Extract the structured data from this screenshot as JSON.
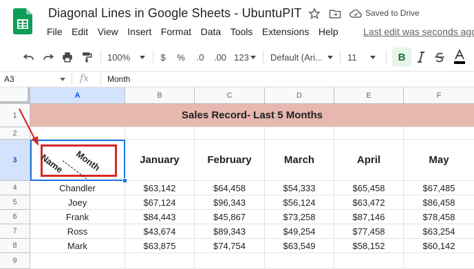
{
  "doc": {
    "title": "Diagonal Lines in Google Sheets - UbuntuPIT",
    "saved_status": "Saved to Drive",
    "last_edit": "Last edit was seconds ago"
  },
  "menu": [
    "File",
    "Edit",
    "View",
    "Insert",
    "Format",
    "Data",
    "Tools",
    "Extensions",
    "Help"
  ],
  "toolbar": {
    "zoom": "100%",
    "currency": "$",
    "percent": "%",
    "decrease_decimal": ".0",
    "increase_decimal": ".00",
    "more_formats": "123",
    "font": "Default (Ari...",
    "font_size": "11",
    "bold": "B"
  },
  "formula_bar": {
    "cell_ref": "A3",
    "fx": "fx",
    "content": "Month"
  },
  "sheet": {
    "columns": [
      "A",
      "B",
      "C",
      "D",
      "E",
      "F"
    ],
    "rows": [
      "1",
      "2",
      "3",
      "4",
      "5",
      "6",
      "7",
      "8",
      "9"
    ],
    "title_text": "Sales Record- Last 5 Months",
    "diag_left": "Name",
    "diag_right": "Month",
    "months": [
      "January",
      "February",
      "March",
      "April",
      "May"
    ],
    "data": [
      [
        "Chandler",
        "$63,142",
        "$64,458",
        "$54,333",
        "$65,458",
        "$67,485"
      ],
      [
        "Joey",
        "$67,124",
        "$96,343",
        "$56,124",
        "$63,472",
        "$86,458"
      ],
      [
        "Frank",
        "$84,443",
        "$45,867",
        "$73,258",
        "$87,146",
        "$78,458"
      ],
      [
        "Ross",
        "$43,674",
        "$89,343",
        "$49,254",
        "$77,458",
        "$63,254"
      ],
      [
        "Mark",
        "$63,875",
        "$74,754",
        "$63,549",
        "$58,152",
        "$60,142"
      ]
    ]
  },
  "colors": {
    "title_fill": "#e6b8af",
    "selection": "#1a73e8",
    "annotation": "#d62626",
    "sheets_green": "#0f9d58"
  }
}
